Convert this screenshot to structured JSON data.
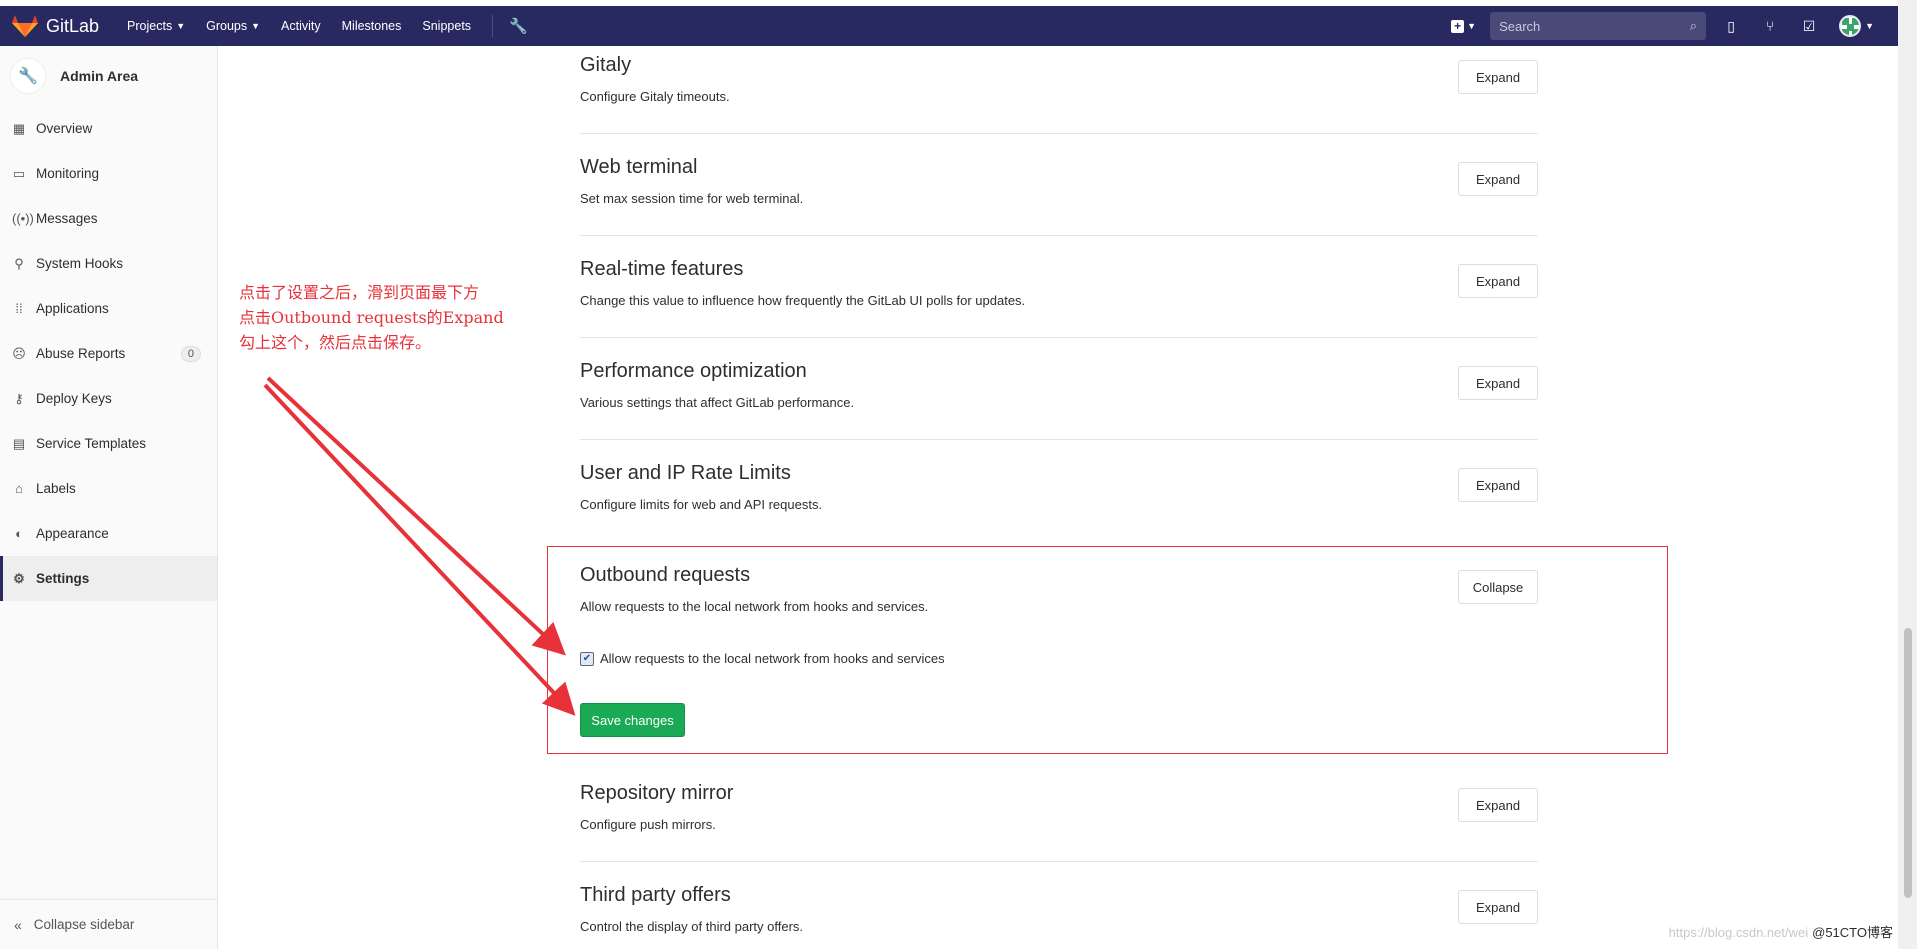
{
  "header": {
    "brand": "GitLab",
    "nav": [
      "Projects",
      "Groups",
      "Activity",
      "Milestones",
      "Snippets"
    ],
    "search_placeholder": "Search"
  },
  "sidebar": {
    "title": "Admin Area",
    "items": [
      {
        "label": "Overview",
        "icon": "grid-icon"
      },
      {
        "label": "Monitoring",
        "icon": "monitor-icon"
      },
      {
        "label": "Messages",
        "icon": "broadcast-icon"
      },
      {
        "label": "System Hooks",
        "icon": "hook-icon"
      },
      {
        "label": "Applications",
        "icon": "apps-icon"
      },
      {
        "label": "Abuse Reports",
        "icon": "abuse-icon",
        "badge": "0"
      },
      {
        "label": "Deploy Keys",
        "icon": "key-icon"
      },
      {
        "label": "Service Templates",
        "icon": "template-icon"
      },
      {
        "label": "Labels",
        "icon": "label-icon"
      },
      {
        "label": "Appearance",
        "icon": "palette-icon"
      },
      {
        "label": "Settings",
        "icon": "gear-icon",
        "active": true
      }
    ],
    "collapse_label": "Collapse sidebar"
  },
  "sections": [
    {
      "title": "Gitaly",
      "desc": "Configure Gitaly timeouts.",
      "button": "Expand"
    },
    {
      "title": "Web terminal",
      "desc": "Set max session time for web terminal.",
      "button": "Expand"
    },
    {
      "title": "Real-time features",
      "desc": "Change this value to influence how frequently the GitLab UI polls for updates.",
      "button": "Expand"
    },
    {
      "title": "Performance optimization",
      "desc": "Various settings that affect GitLab performance.",
      "button": "Expand"
    },
    {
      "title": "User and IP Rate Limits",
      "desc": "Configure limits for web and API requests.",
      "button": "Expand"
    },
    {
      "title": "Outbound requests",
      "desc": "Allow requests to the local network from hooks and services.",
      "button": "Collapse"
    },
    {
      "title": "Repository mirror",
      "desc": "Configure push mirrors.",
      "button": "Expand"
    },
    {
      "title": "Third party offers",
      "desc": "Control the display of third party offers.",
      "button": "Expand"
    }
  ],
  "outbound": {
    "checkbox_label": "Allow requests to the local network from hooks and services",
    "checked": true,
    "save_label": "Save changes"
  },
  "annotation": {
    "lines": [
      "点击了设置之后，滑到页面最下方",
      "点击Outbound requests的Expand",
      "勾上这个，然后点击保存。"
    ],
    "color": "#e8323a"
  },
  "watermark": {
    "url": "https://blog.csdn.net/wei",
    "credit": "@51CTO博客"
  }
}
